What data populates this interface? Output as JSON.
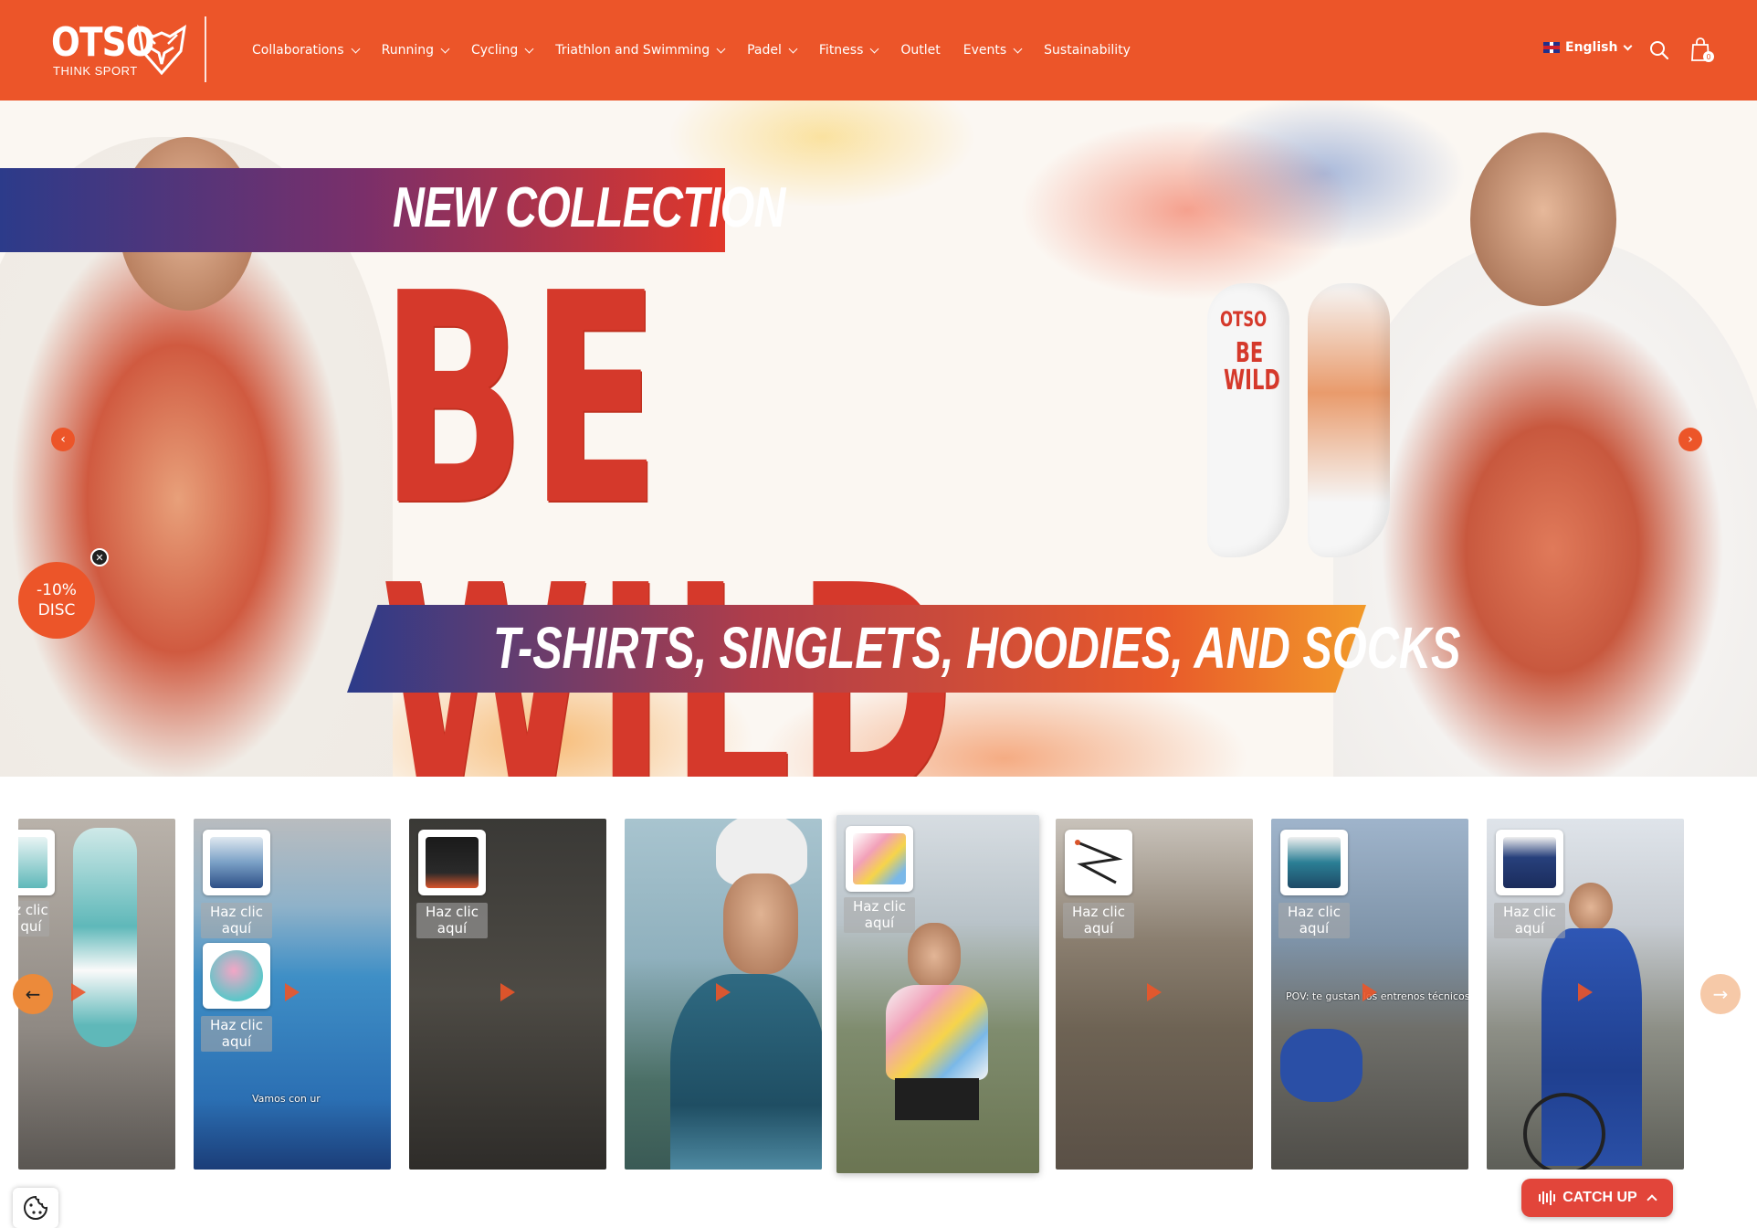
{
  "header": {
    "brand": "OTSO",
    "tagline": "THINK SPORT",
    "nav": [
      {
        "label": "Collaborations",
        "has_dropdown": true
      },
      {
        "label": "Running",
        "has_dropdown": true
      },
      {
        "label": "Cycling",
        "has_dropdown": true
      },
      {
        "label": "Triathlon and Swimming",
        "has_dropdown": true
      },
      {
        "label": "Padel",
        "has_dropdown": true
      },
      {
        "label": "Fitness",
        "has_dropdown": true
      },
      {
        "label": "Outlet",
        "has_dropdown": false
      },
      {
        "label": "Events",
        "has_dropdown": true
      },
      {
        "label": "Sustainability",
        "has_dropdown": false
      }
    ],
    "language": "English",
    "cart_count": "0",
    "icons": {
      "search": "search-icon",
      "cart": "shopping-bag-icon",
      "logo": "fox-logo-icon"
    },
    "accent_color": "#ec5529"
  },
  "hero": {
    "banner_top": "NEW COLLECTION",
    "headline": "BE WILD",
    "banner_bottom": "T-SHIRTS, SINGLETS, HOODIES, AND SOCKS",
    "sock_brand": "OTSO",
    "sock_text_1": "BE",
    "sock_text_2": "WILD",
    "title_color": "#d5392b"
  },
  "discount_badge": {
    "line1": "-10%",
    "line2": "DISC"
  },
  "carousel": {
    "cta_label": "Haz clic aquí",
    "cta_label_1": "Haz clic",
    "cta_label_2": "aquí",
    "partial_label_1": "z clic",
    "partial_label_2": "quí",
    "caption_pool": "Vamos con ur",
    "caption_mountain": "POV: te gustan los entrenos técnicos"
  },
  "catch_up": {
    "label": "CATCH UP"
  }
}
